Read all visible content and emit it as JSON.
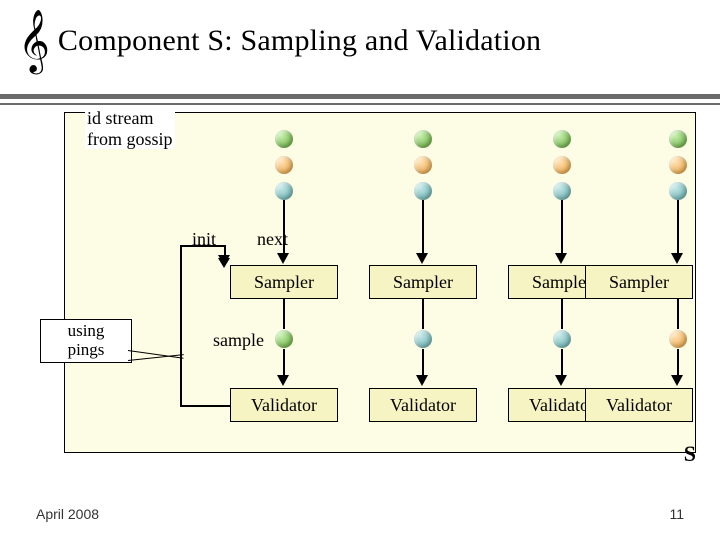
{
  "title": "Component S: Sampling and Validation",
  "stream_label": "id stream\nfrom gossip",
  "init_label": "init",
  "next_label": "next",
  "sample_label": "sample",
  "sampler_label": "Sampler",
  "validator_label": "Validator",
  "callout_text": "using\npings",
  "corner_s": "S",
  "footer_date": "April 2008",
  "footer_page": "11",
  "chart_data": {
    "type": "diagram",
    "title": "Component S: Sampling and Validation",
    "columns": 4,
    "input": "id stream from gossip",
    "per_column_stream_colors": [
      "green",
      "orange",
      "blue"
    ],
    "blocks": [
      {
        "name": "Sampler",
        "count": 4,
        "inputs": [
          "id stream (next)",
          "init loop from Validator"
        ],
        "output": "sample"
      },
      {
        "name": "Validator",
        "count": 4,
        "inputs": [
          "sample from Sampler"
        ],
        "note": "using pings",
        "feedback": "init to Sampler"
      }
    ],
    "feedback_loop": {
      "from": "Validator",
      "to": "Sampler",
      "label": "init"
    },
    "labels": [
      "init",
      "next",
      "sample"
    ],
    "corner_label": "S"
  }
}
